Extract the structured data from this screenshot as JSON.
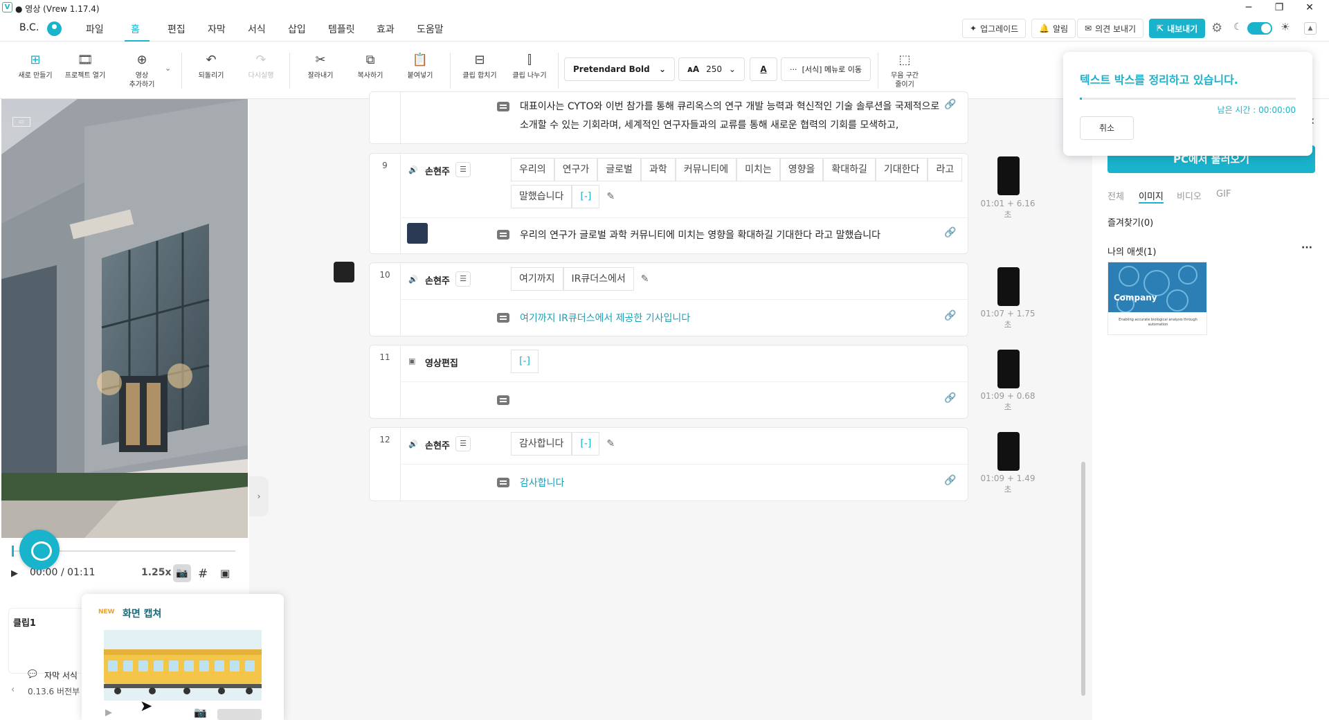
{
  "app": {
    "title": "● 영상 (Vrew 1.17.4)",
    "logo": "V"
  },
  "window_controls": {
    "minimize": "─",
    "maximize": "❐",
    "close": "✕"
  },
  "menubar": {
    "user": "B.C.",
    "items": [
      "파일",
      "홈",
      "편집",
      "자막",
      "서식",
      "삽입",
      "템플릿",
      "효과",
      "도움말"
    ],
    "active": "홈",
    "upgrade": "업그레이드",
    "alert": "알림",
    "feedback": "의견 보내기",
    "export": "내보내기"
  },
  "toolbar": {
    "new": "새로 만들기",
    "open": "프로젝트 열기",
    "add_video_1": "영상",
    "add_video_2": "추가하기",
    "undo": "되돌리기",
    "redo": "다시실행",
    "cut": "잘라내기",
    "copy": "복사하기",
    "paste": "붙여넣기",
    "merge": "클립 합치기",
    "split": "클립 나누기",
    "font": "Pretendard Bold",
    "font_size": "250",
    "format_menu": "[서식] 메뉴로 이동",
    "silence_1": "무음 구간",
    "silence_2": "줄이기"
  },
  "player": {
    "time_current": "00:00",
    "time_total": "/ 01:11",
    "speed": "1.25x",
    "clip_label": "클립1",
    "subtitle_format": "자막 서식",
    "version_note": "0.13.6 버전부"
  },
  "popover": {
    "badge": "NEW",
    "title": "화면 캡쳐"
  },
  "rows": [
    {
      "num": "",
      "subtitle_line1": "대표이사는 CYTO와 이번 참가를 통해 큐리옥스의 연구 개발 능력과 혁신적인 기술 솔루션을 국제적으로",
      "subtitle_line2": "소개할 수 있는 기회라며, 세계적인 연구자들과의 교류를 통해 새로운 협력의 기회를 모색하고,"
    },
    {
      "num": "9",
      "speaker": "손현주",
      "words": [
        "우리의",
        "연구가",
        "글로벌",
        "과학",
        "커뮤니티에",
        "미치는",
        "영향을",
        "확대하길",
        "기대한다",
        "라고"
      ],
      "words2": [
        "말했습니다",
        "[-]"
      ],
      "subtitle": "우리의 연구가 글로벌 과학 커뮤니티에 미치는 영향을 확대하길 기대한다 라고 말했습니다",
      "time": "01:01 + 6.16초"
    },
    {
      "num": "10",
      "speaker": "손현주",
      "words": [
        "여기까지",
        "IR큐더스에서"
      ],
      "subtitle": "여기까지 IR큐더스에서 제공한 기사입니다",
      "time": "01:07 + 1.75초"
    },
    {
      "num": "11",
      "speaker": "영상편집",
      "words": [
        "[-]"
      ],
      "subtitle": "",
      "time": "01:09 + 0.68초"
    },
    {
      "num": "12",
      "speaker": "손현주",
      "words": [
        "감사합니다",
        "[-]"
      ],
      "subtitle": "감사합니다",
      "time": "01:09 + 1.49초"
    }
  ],
  "right_panel": {
    "import_button": "PC에서 불러오기",
    "tabs": [
      "전체",
      "이미지",
      "비디오",
      "GIF"
    ],
    "active_tab": "이미지",
    "favorites": "즐겨찾기(0)",
    "my_assets": "나의 애셋(1)",
    "more": "···",
    "asset_caption": "Company",
    "asset_sub": "Enabling accurate biological analysis through automation"
  },
  "toast": {
    "title": "텍스트 박스를 정리하고 있습니다.",
    "progress": 0.01,
    "time_left": "남은 시간 : 00:00:00",
    "cancel": "취소"
  },
  "colors": {
    "accent": "#1ab3cc",
    "text": "#333333",
    "teal_text": "#1a9fb6"
  }
}
